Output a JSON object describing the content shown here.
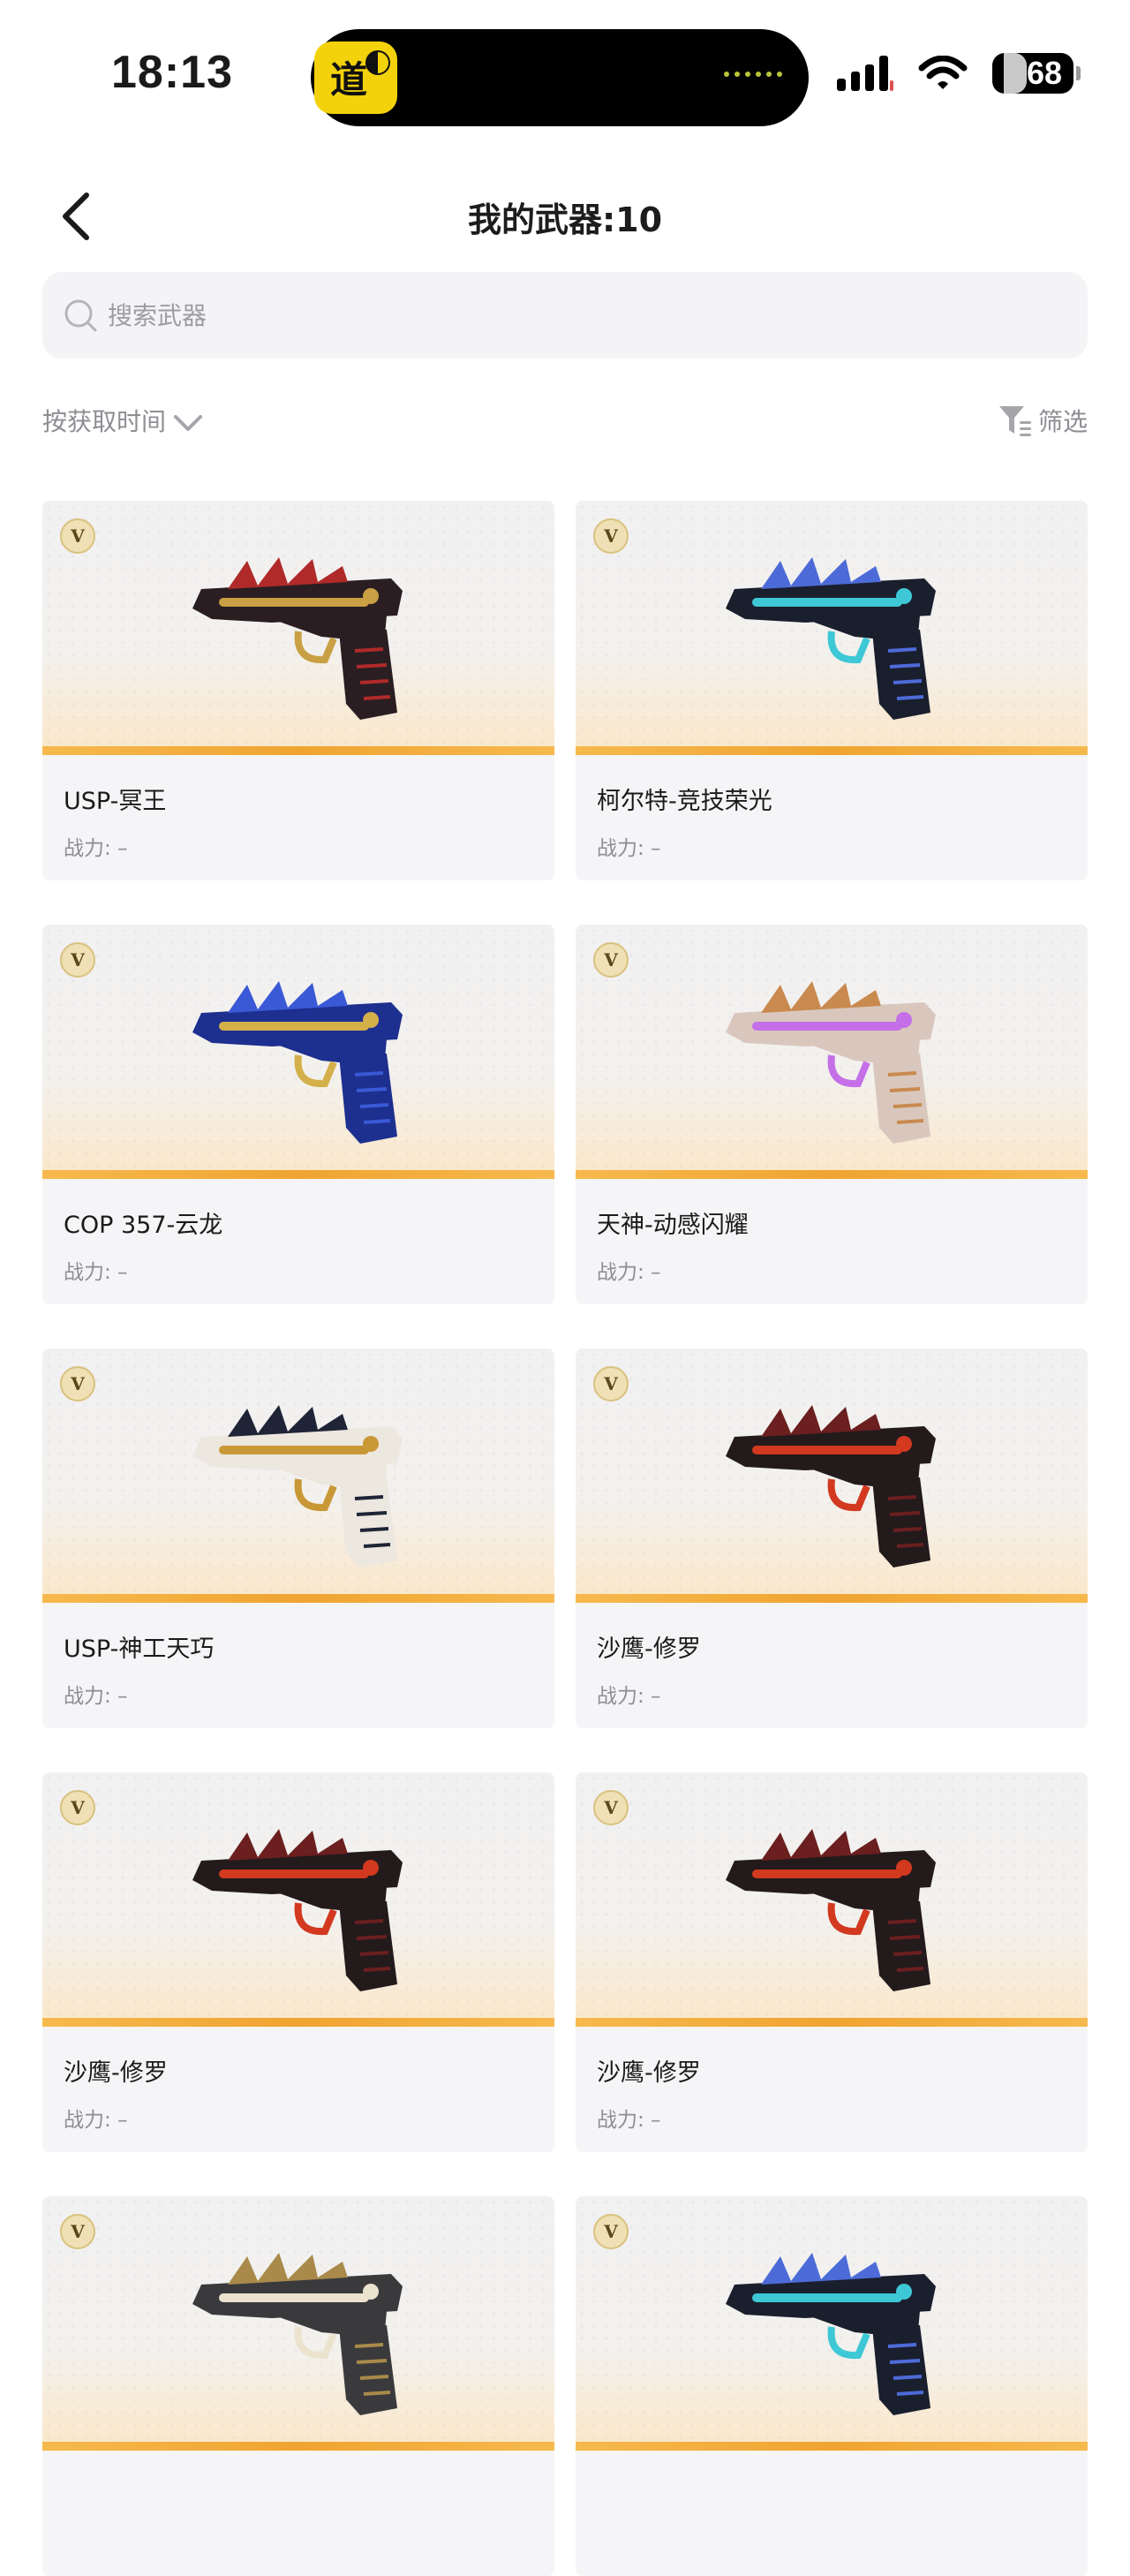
{
  "status_bar": {
    "time": "18:13",
    "battery": "68",
    "island_app_glyph": "道"
  },
  "nav": {
    "title": "我的武器:10"
  },
  "search": {
    "placeholder": "搜索武器",
    "value": ""
  },
  "sort": {
    "label": "按获取时间"
  },
  "filter": {
    "label": "筛选"
  },
  "badge_letter": "V",
  "weapons": [
    {
      "name": "USP-冥王",
      "power": "战力: –",
      "icon": "pistol-dragon-icon",
      "colors": [
        "#2a1e22",
        "#b02a2a",
        "#c9a043"
      ]
    },
    {
      "name": "柯尔特-竞技荣光",
      "power": "战力: –",
      "icon": "pistol-colt-icon",
      "colors": [
        "#1a1f2e",
        "#4d6bd8",
        "#3ec8d6"
      ]
    },
    {
      "name": "COP 357-云龙",
      "power": "战力: –",
      "icon": "revolver-cloud-dragon-icon",
      "colors": [
        "#1d2f8f",
        "#3a59d6",
        "#d4b04a"
      ]
    },
    {
      "name": "天神-动感闪耀",
      "power": "战力: –",
      "icon": "pistol-shine-icon",
      "colors": [
        "#d9c7bd",
        "#c98a4f",
        "#c46fe8"
      ]
    },
    {
      "name": "USP-神工天巧",
      "power": "战力: –",
      "icon": "pistol-craft-icon",
      "colors": [
        "#ece7df",
        "#1f2537",
        "#c99836"
      ]
    },
    {
      "name": "沙鹰-修罗",
      "power": "战力: –",
      "icon": "desert-eagle-asura-icon",
      "colors": [
        "#231a1c",
        "#6b1f1f",
        "#d2391f"
      ]
    },
    {
      "name": "沙鹰-修罗",
      "power": "战力: –",
      "icon": "desert-eagle-asura-icon",
      "colors": [
        "#231a1c",
        "#6b1f1f",
        "#d2391f"
      ]
    },
    {
      "name": "沙鹰-修罗",
      "power": "战力: –",
      "icon": "desert-eagle-asura-icon",
      "colors": [
        "#231a1c",
        "#6b1f1f",
        "#d2391f"
      ]
    },
    {
      "name": "",
      "power": "",
      "icon": "pistol-gold-dragon-icon",
      "colors": [
        "#3a3a3d",
        "#a98a4a",
        "#ece3cf"
      ]
    },
    {
      "name": "",
      "power": "",
      "icon": "pistol-colt-icon",
      "colors": [
        "#1a1f2e",
        "#4d6bd8",
        "#3ec8d6"
      ]
    }
  ]
}
